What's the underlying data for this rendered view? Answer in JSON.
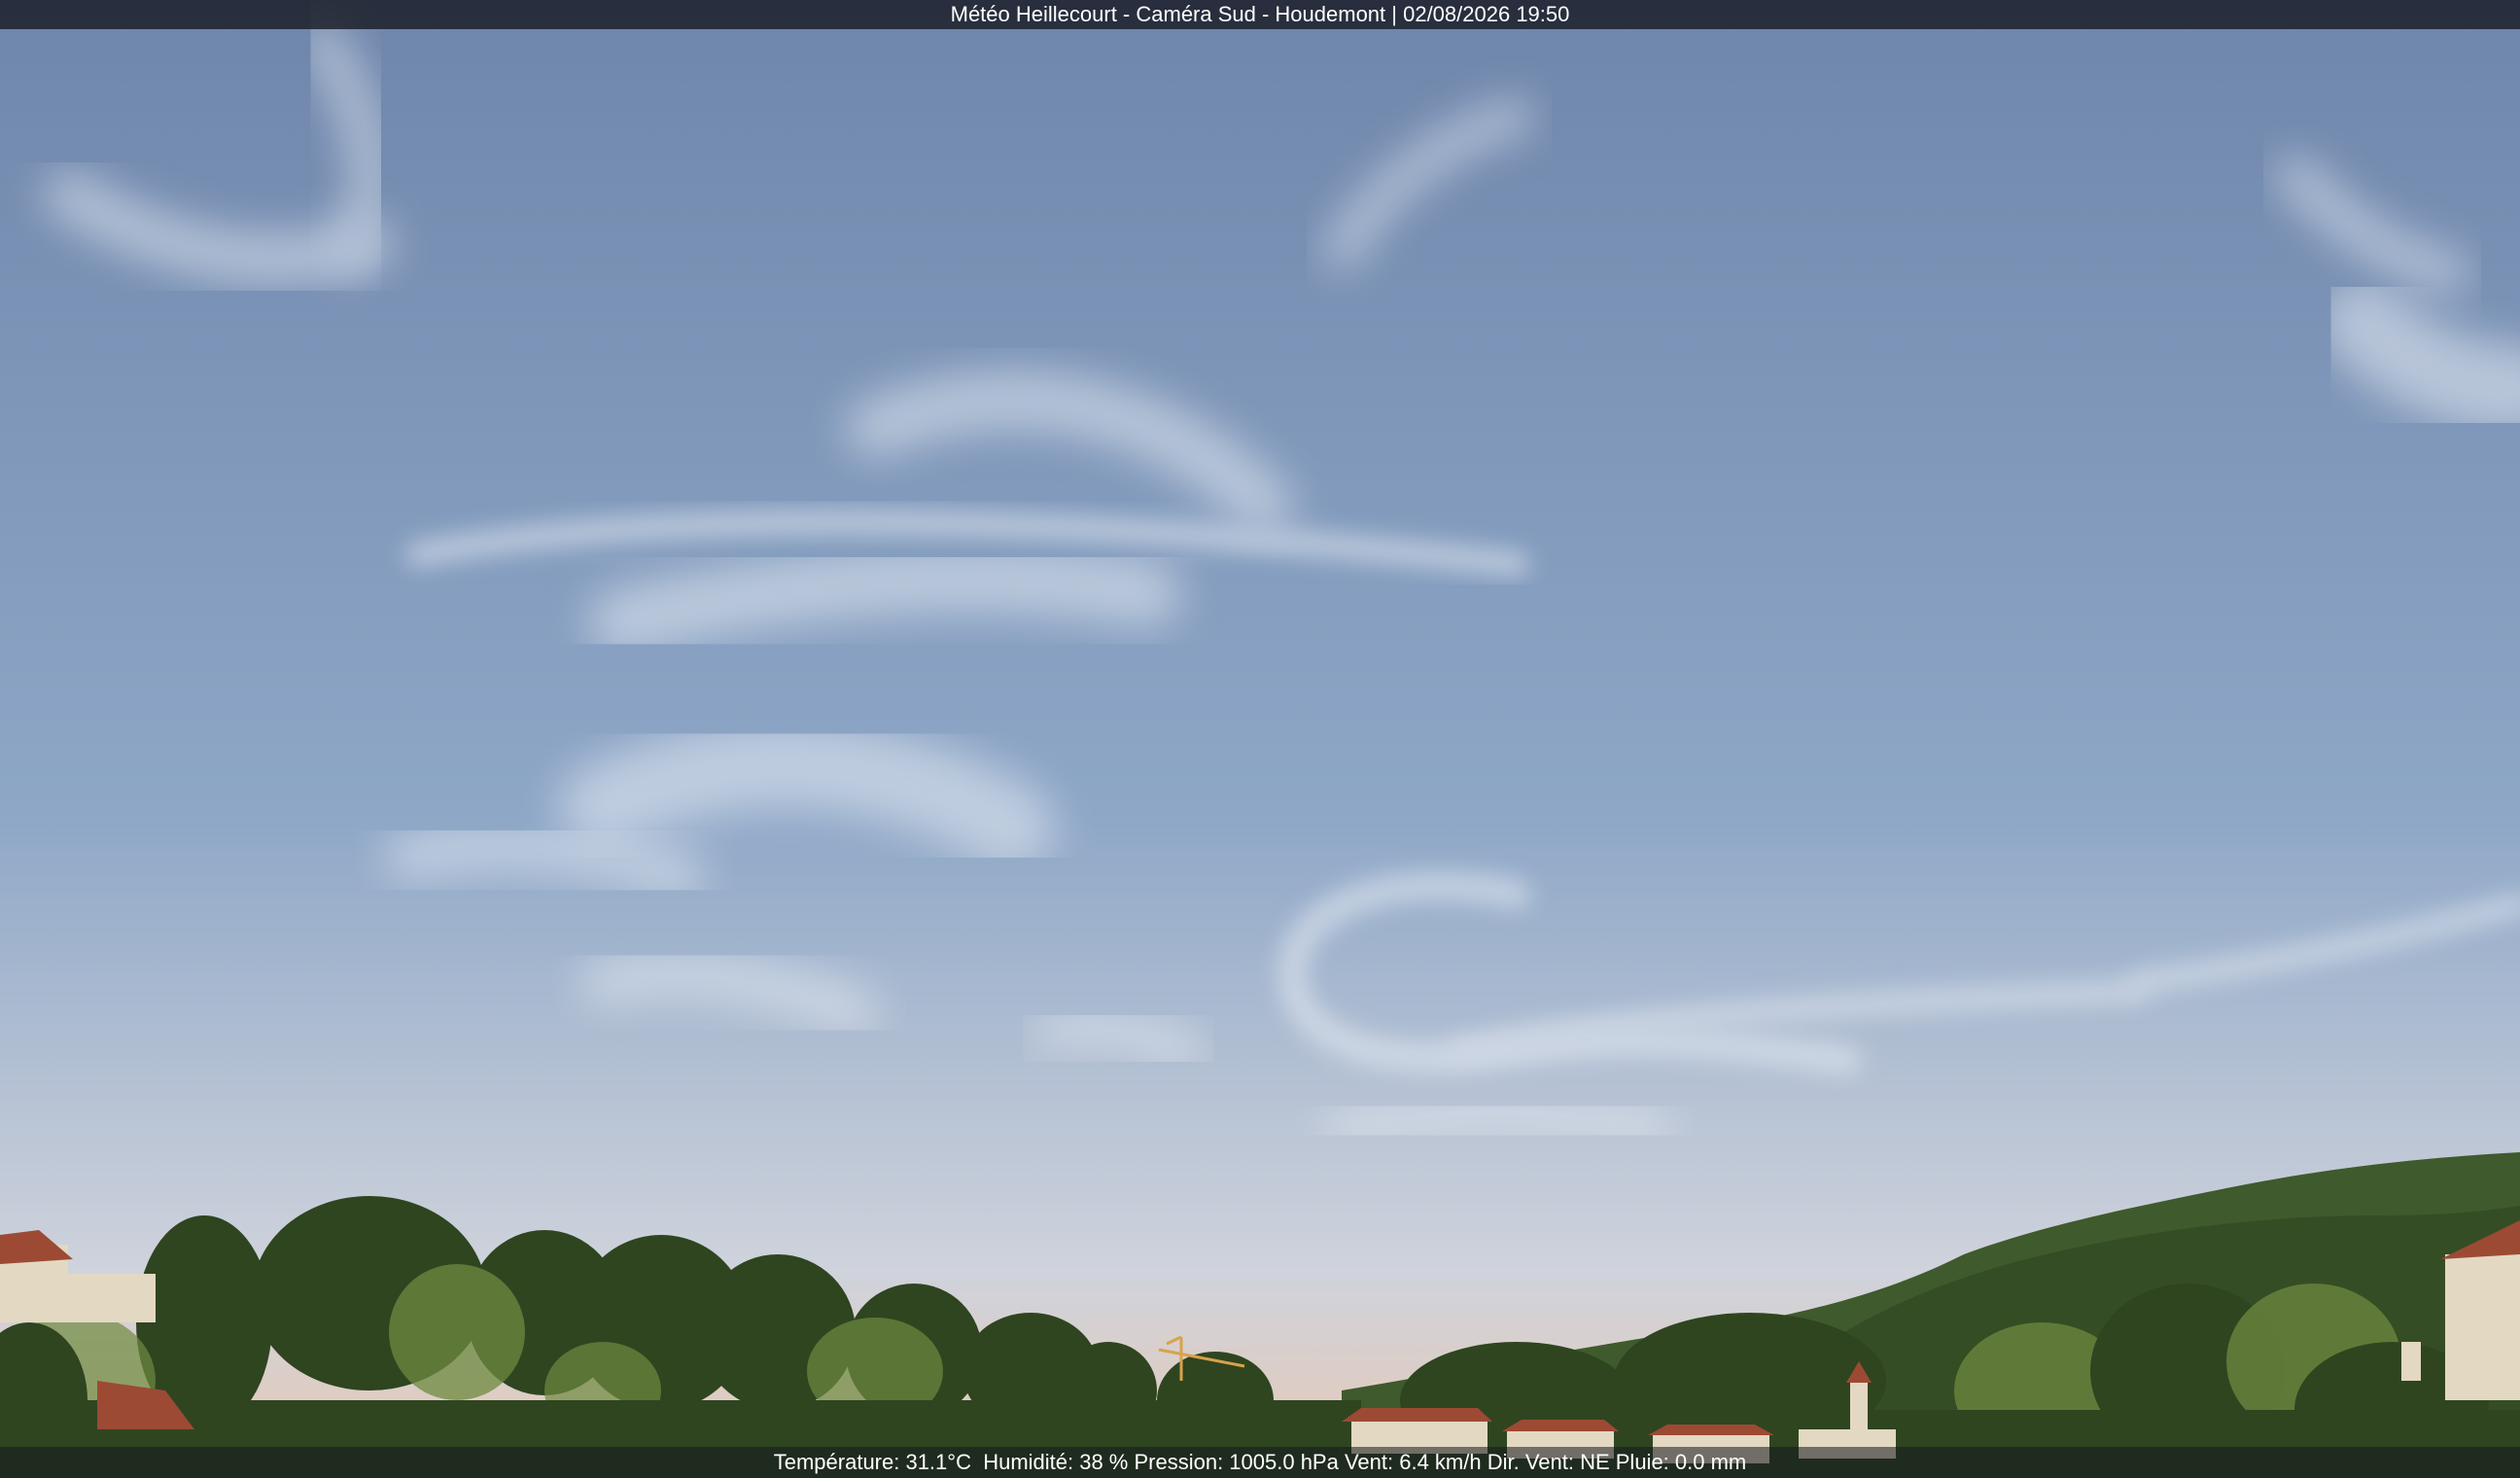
{
  "overlay": {
    "title": "Météo Heillecourt - Caméra Sud - Houdemont | 02/08/2026 19:50",
    "readings": "Température: 31.1°C  Humidité: 38 % Pression: 1005.0 hPa Vent: 6.4 km/h Dir. Vent: NE Pluie: 0.0 mm"
  },
  "scene": {
    "sky_top_color": "#6f86ab",
    "sky_mid_color": "#8ea7c7",
    "sky_horizon_color": "#cfd3dc",
    "horizon_glow_color": "#e7c9b4",
    "cloud_color": "#e8edf4",
    "hill_color": "#3f5a2c",
    "tree_dark_color": "#2e4520",
    "tree_light_color": "#6e8a3f",
    "roof_color": "#9c4a34",
    "wall_color": "#e3d8c2",
    "crane_color": "#d9a24a"
  }
}
